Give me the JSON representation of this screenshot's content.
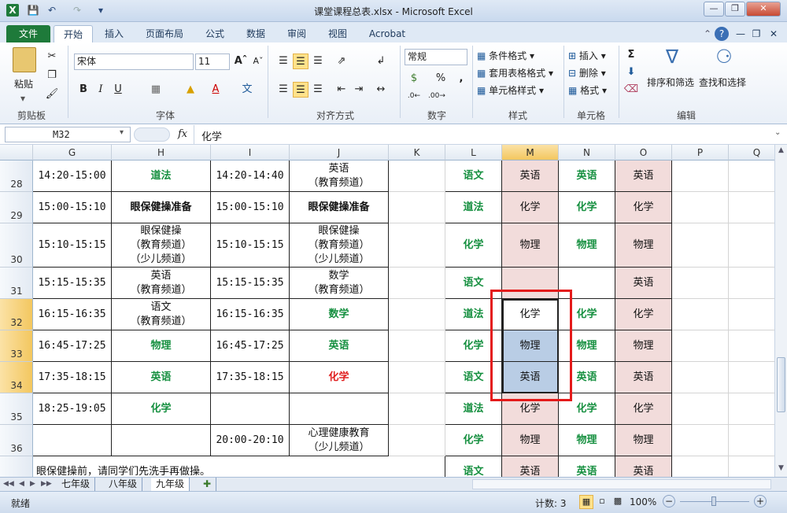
{
  "app": {
    "title": "课堂课程总表.xlsx - Microsoft Excel"
  },
  "ribbon": {
    "tabs": [
      "文件",
      "开始",
      "插入",
      "页面布局",
      "公式",
      "数据",
      "审阅",
      "视图",
      "Acrobat"
    ],
    "font_name": "宋体",
    "font_size": "11",
    "number_format": "常规",
    "buttons": {
      "paste": "粘贴",
      "cond_format": "条件格式",
      "table_format": "套用表格格式",
      "cell_style": "单元格样式",
      "insert": "插入",
      "delete": "删除",
      "format": "格式",
      "sort_filter": "排序和筛选",
      "find_select": "查找和选择"
    },
    "groups": [
      "剪贴板",
      "字体",
      "对齐方式",
      "数字",
      "样式",
      "单元格",
      "编辑"
    ]
  },
  "formula_bar": {
    "name_box": "M32",
    "fx": "fx",
    "content": "化学"
  },
  "columns": [
    "G",
    "H",
    "I",
    "J",
    "K",
    "L",
    "M",
    "N",
    "O",
    "P",
    "Q"
  ],
  "rows": [
    {
      "num": "28",
      "G": "14:20-15:00",
      "H": "道法",
      "I": "14:20-14:40",
      "J": "英语\n（教育频道）",
      "L": "语文",
      "M": "英语",
      "N": "英语",
      "O": "英语"
    },
    {
      "num": "29",
      "G": "15:00-15:10",
      "H": "眼保健操准备",
      "I": "15:00-15:10",
      "J": "眼保健操准备",
      "L": "道法",
      "M": "化学",
      "N": "化学",
      "O": "化学"
    },
    {
      "num": "30",
      "G": "15:10-15:15",
      "H": "眼保健操\n（教育频道）\n（少儿频道）",
      "I": "15:10-15:15",
      "J": "眼保健操\n（教育频道）\n（少儿频道）",
      "L": "化学",
      "M": "物理",
      "N": "物理",
      "O": "物理"
    },
    {
      "num": "31",
      "G": "15:15-15:35",
      "H": "英语\n（教育频道）",
      "I": "15:15-15:35",
      "J": "数学\n（教育频道）",
      "L": "语文",
      "M": "",
      "N": "",
      "O": "英语"
    },
    {
      "num": "32",
      "G": "16:15-16:35",
      "H": "语文\n（教育频道）",
      "I": "16:15-16:35",
      "J": "数学",
      "L": "道法",
      "M": "化学",
      "N": "化学",
      "O": "化学"
    },
    {
      "num": "33",
      "G": "16:45-17:25",
      "H": "物理",
      "I": "16:45-17:25",
      "J": "英语",
      "L": "化学",
      "M": "物理",
      "N": "物理",
      "O": "物理"
    },
    {
      "num": "34",
      "G": "17:35-18:15",
      "H": "英语",
      "I": "17:35-18:15",
      "J": "化学",
      "L": "语文",
      "M": "英语",
      "N": "英语",
      "O": "英语"
    },
    {
      "num": "35",
      "G": "18:25-19:05",
      "H": "化学",
      "I": "",
      "J": "",
      "L": "道法",
      "M": "化学",
      "N": "化学",
      "O": "化学"
    },
    {
      "num": "36",
      "G": "",
      "H": "",
      "I": "20:00-20:10",
      "J": "心理健康教育\n（少儿频道）",
      "L": "化学",
      "M": "物理",
      "N": "物理",
      "O": "物理"
    },
    {
      "num": "",
      "G": "眼保健操前，请同学们先洗手再做操。",
      "H": "",
      "I": "",
      "J": "",
      "L": "语文",
      "M": "英语",
      "N": "英语",
      "O": "英语"
    }
  ],
  "sheets": [
    "七年级",
    "八年级",
    "九年级"
  ],
  "status": {
    "ready": "就绪",
    "count": "计数: 3",
    "zoom": "100%"
  },
  "colors": {
    "accent_green": "#169040",
    "accent_red": "#e02020",
    "pink_fill": "#f2dcdb",
    "blue_fill": "#b9cde5",
    "highlight_box": "#e41a1a"
  }
}
